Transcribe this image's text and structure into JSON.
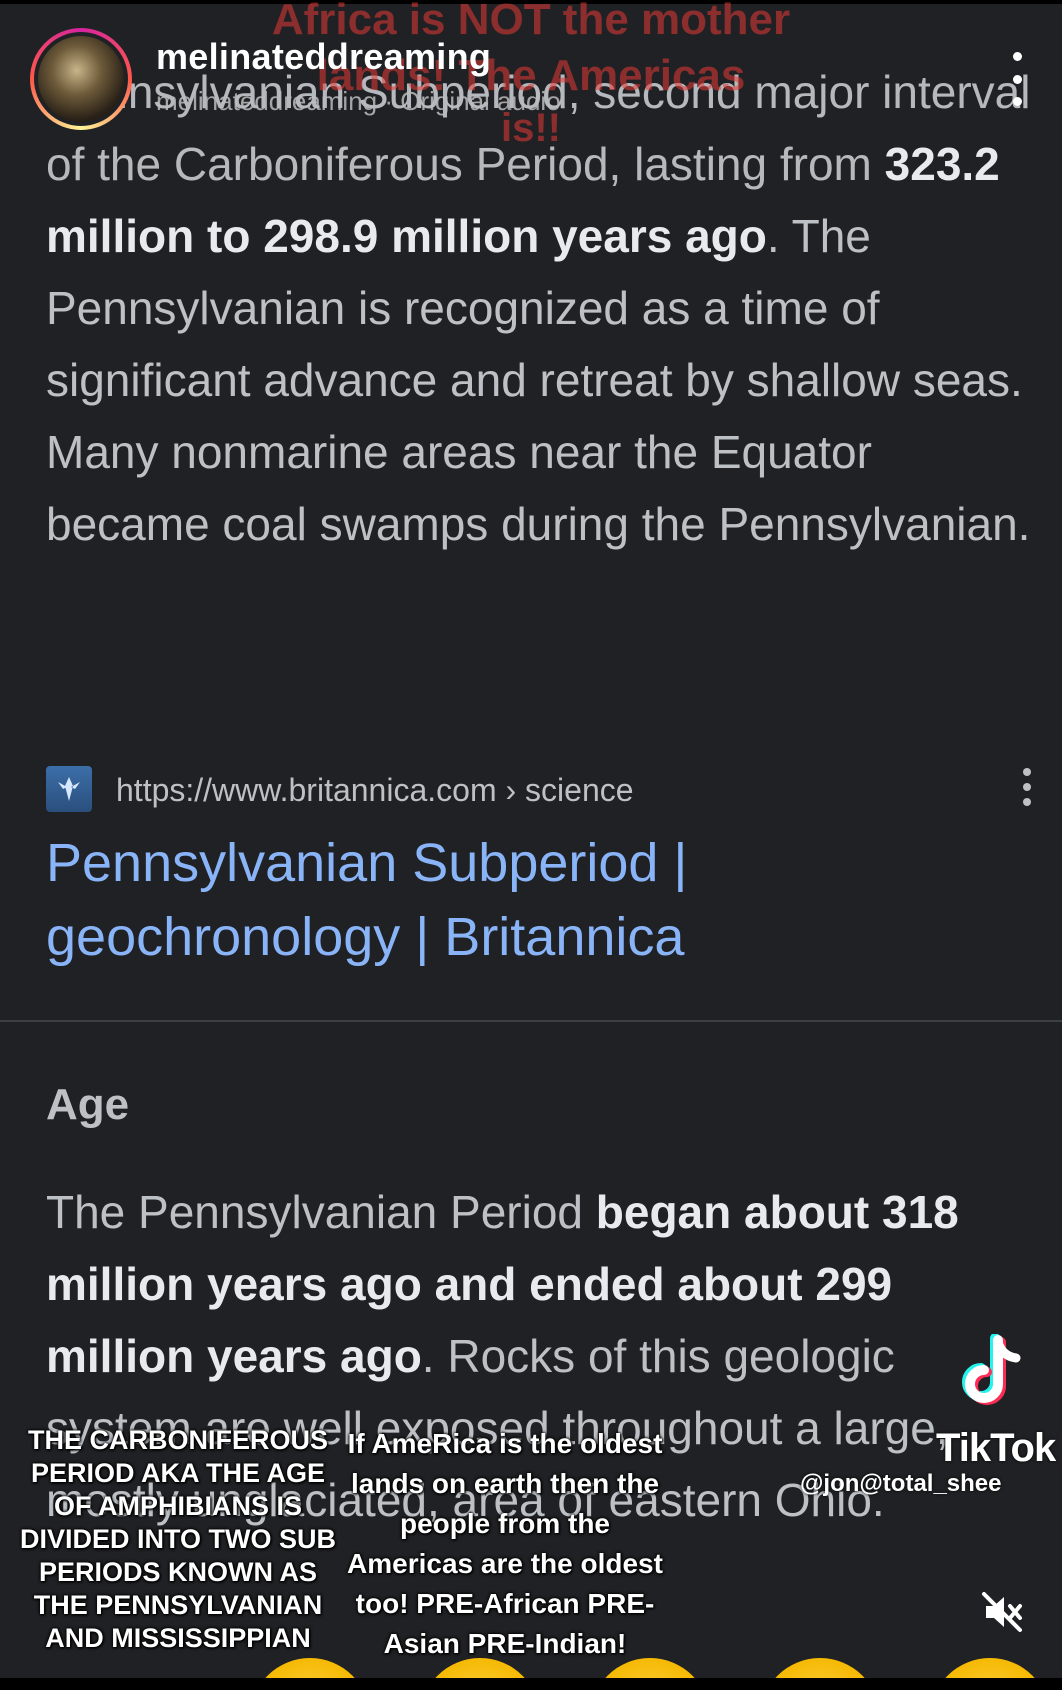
{
  "header": {
    "username": "melinateddreaming",
    "audio_line": "melinateddreaming · Original audio",
    "overlay_title_line1": "Africa is NOT the mother",
    "overlay_title_line2": "lands! The Americas",
    "overlay_title_line3": "is!!"
  },
  "result": {
    "para1_intro": "Pennsylvanian Subperiod, second major interval of the Carboniferous Period, lasting from",
    "para1_bold": "323.2 million to 298.9 million years ago",
    "para1_rest": ". The Pennsylvanian is recognized as a time of significant advance and retreat by shallow seas. Many nonmarine areas near the Equator became coal swamps during the Pennsylvanian.",
    "source_url": "https://www.britannica.com › science",
    "title_line1": "Pennsylvanian Subperiod |",
    "title_line2": "geochronology | Britannica"
  },
  "age_section": {
    "heading": "Age",
    "intro": "The Pennsylvanian Period",
    "bold": "began about 318 million years ago and ended about 299 million years ago",
    "rest": ". Rocks of this geologic system are well exposed throughout a large, mostly unglaciated, area of eastern Ohio."
  },
  "captions": {
    "left": [
      "THE CARBONIFEROUS",
      "PERIOD AKA THE AGE",
      "OF AMPHIBIANS IS",
      "DIVIDED INTO TWO SUB",
      "PERIODS KNOWN AS",
      "THE PENNSYLVANIAN",
      "AND MISSISSIPPIAN"
    ],
    "center": [
      "If AmeRica is the oldest",
      "lands on earth then the",
      "people from the",
      "Americas are the oldest",
      "too! PRE-African PRE-",
      "Asian PRE-Indian!"
    ]
  },
  "watermark": {
    "brand": "TikTok",
    "handle": "@jon@total_shee"
  },
  "colors": {
    "background": "#202124",
    "link": "#8ab4f8",
    "overlay_red": "#e53935"
  },
  "icons": {
    "more_top": "more-vertical-icon",
    "favicon": "britannica-favicon",
    "more_result": "more-vertical-icon",
    "tiktok": "tiktok-logo-icon",
    "mute": "muted-speaker-icon"
  }
}
